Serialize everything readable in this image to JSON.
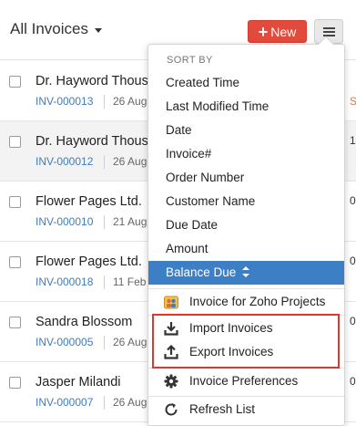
{
  "header": {
    "title": "All Invoices",
    "new_button": {
      "plus": "+",
      "label": "New"
    },
    "menu_icon": "hamburger-menu-icon"
  },
  "invoices": [
    {
      "name": "Dr. Hayword Thous",
      "number": "INV-000013",
      "date": "26 Aug",
      "edge": ""
    },
    {
      "name": "Dr. Hayword Thous",
      "number": "INV-000012",
      "date": "26 Aug",
      "edge": "1"
    },
    {
      "name": "Flower Pages Ltd.",
      "number": "INV-000010",
      "date": "21 Aug",
      "edge": "0"
    },
    {
      "name": "Flower Pages Ltd.",
      "number": "INV-000018",
      "date": "11 Feb",
      "edge": "0"
    },
    {
      "name": "Sandra Blossom",
      "number": "INV-000005",
      "date": "26 Aug",
      "edge": "0"
    },
    {
      "name": "Jasper Milandi",
      "number": "INV-000007",
      "date": "26 Aug",
      "edge": "0"
    }
  ],
  "menu": {
    "sort_header": "SORT BY",
    "sort_options": [
      "Created Time",
      "Last Modified Time",
      "Date",
      "Invoice#",
      "Order Number",
      "Customer Name",
      "Due Date",
      "Amount",
      "Balance Due"
    ],
    "active_sort": "Balance Due",
    "actions": {
      "zoho_projects": "Invoice for Zoho Projects",
      "import": "Import Invoices",
      "export": "Export Invoices",
      "preferences": "Invoice Preferences",
      "refresh": "Refresh List"
    }
  },
  "colors": {
    "accent": "#3d7fc4",
    "new_button": "#e24a3b",
    "link": "#3f7cbf",
    "highlight": "#e0362c"
  }
}
